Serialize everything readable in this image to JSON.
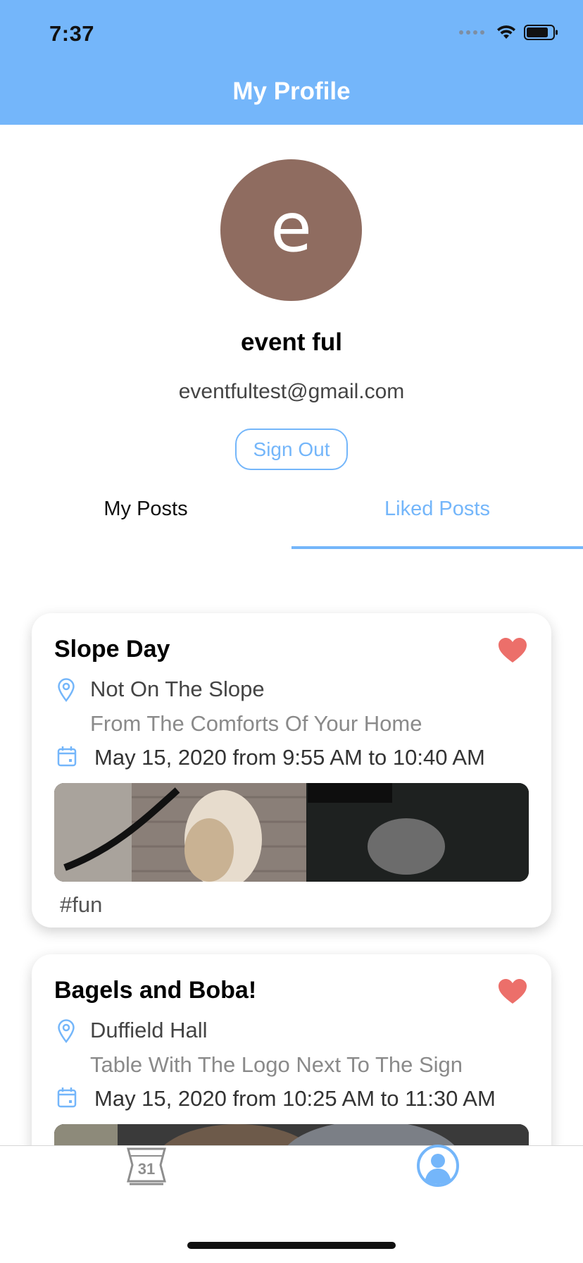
{
  "status_bar": {
    "time": "7:37"
  },
  "header": {
    "title": "My Profile"
  },
  "profile": {
    "avatar_initial": "e",
    "name": "event ful",
    "email": "eventfultest@gmail.com",
    "sign_out_label": "Sign Out"
  },
  "tabs": [
    {
      "label": "My Posts",
      "active": false
    },
    {
      "label": "Liked Posts",
      "active": true
    }
  ],
  "posts": [
    {
      "title": "Slope Day",
      "location": "Not On The Slope",
      "location_detail": "From The Comforts Of Your Home",
      "date": "May 15, 2020 from 9:55 AM to 10:40 AM",
      "tag": "#fun",
      "liked": true
    },
    {
      "title": "Bagels and Boba!",
      "location": "Duffield Hall",
      "location_detail": "Table With The Logo Next To The Sign",
      "date": "May 15, 2020 from 10:25 AM to 11:30 AM",
      "tag": "",
      "liked": true
    }
  ],
  "tab_bar": {
    "items": [
      {
        "icon": "calendar-icon",
        "text": "31"
      },
      {
        "icon": "profile-icon"
      }
    ]
  },
  "colors": {
    "accent": "#74b6fa",
    "avatar": "#8f6c60",
    "heart": "#ec6f6a"
  }
}
